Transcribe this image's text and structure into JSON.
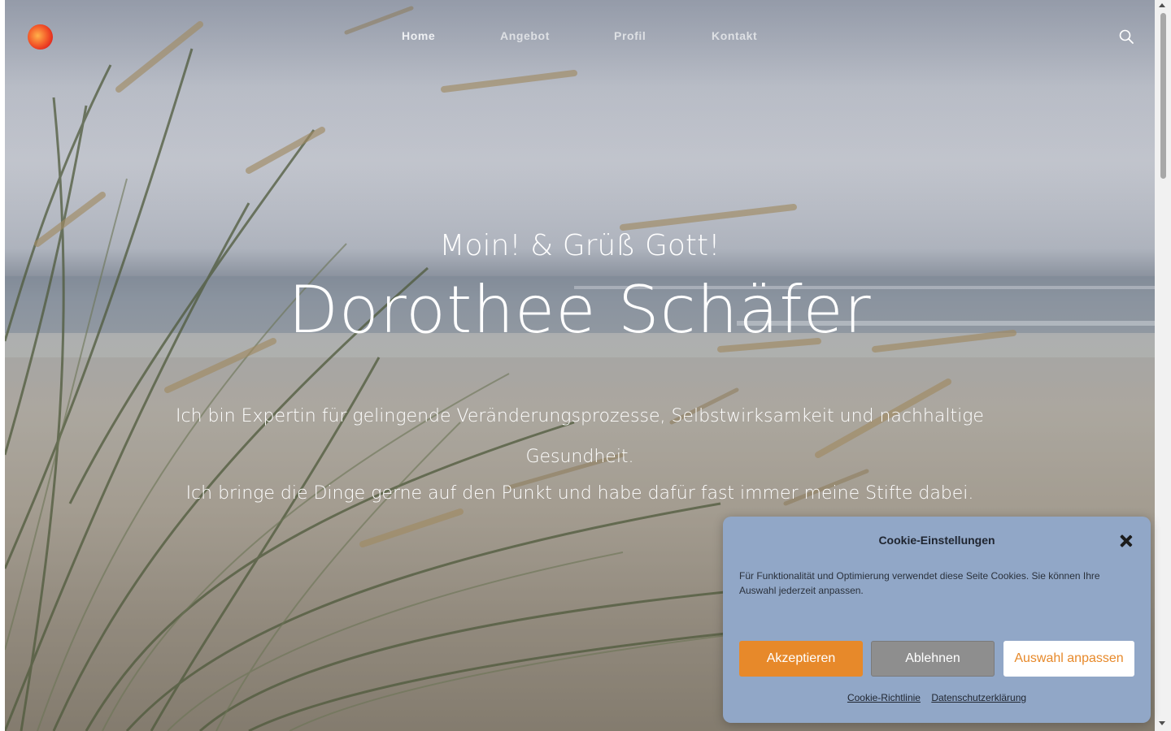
{
  "header": {
    "nav": [
      {
        "label": "Home",
        "active": true
      },
      {
        "label": "Angebot",
        "active": false
      },
      {
        "label": "Profil",
        "active": false
      },
      {
        "label": "Kontakt",
        "active": false
      }
    ],
    "search_icon": "search-icon",
    "logo_colors": [
      "#ffb14a",
      "#f45d2a",
      "#e32a1e"
    ]
  },
  "hero": {
    "greeting": "Moin! & Grüß Gott!",
    "name": "Dorothee Schäfer",
    "intro_line1": "Ich bin Expertin für gelingende Veränderungsprozesse, Selbstwirksamkeit und nachhaltige Gesundheit.",
    "intro_line2": "Ich bringe die Dinge gerne auf den Punkt und habe dafür fast immer meine Stifte dabei."
  },
  "cookie_dialog": {
    "title": "Cookie-Einstellungen",
    "text": "Für Funktionalität und Optimierung verwendet diese Seite Cookies. Sie können Ihre Auswahl jederzeit anpassen.",
    "accept_label": "Akzeptieren",
    "deny_label": "Ablehnen",
    "customize_label": "Auswahl anpassen",
    "link_cookie_policy": "Cookie-Richtlinie",
    "link_privacy": "Datenschutzerklärung",
    "colors": {
      "background": "#91a7c7",
      "accent": "#e7892a",
      "deny": "#8e8e8e"
    }
  }
}
